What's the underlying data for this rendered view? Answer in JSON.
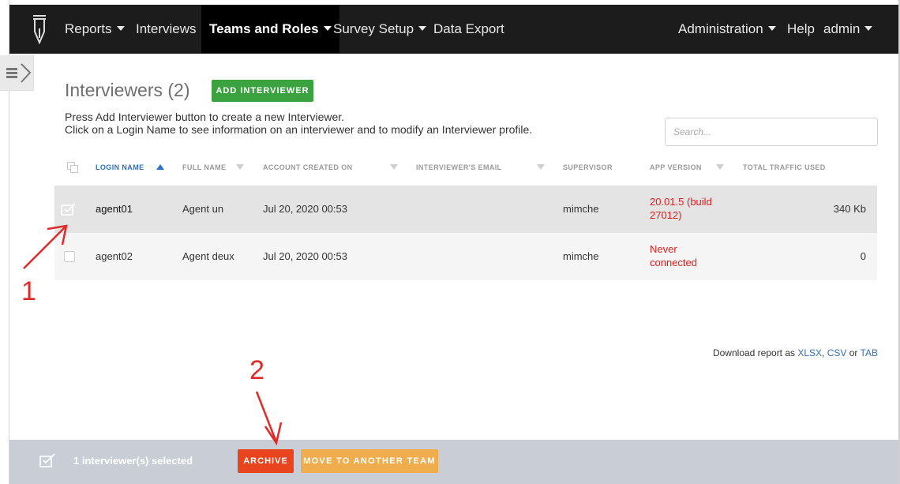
{
  "nav": {
    "items": [
      {
        "label": "Reports",
        "caret": true
      },
      {
        "label": "Interviews",
        "caret": false
      },
      {
        "label": "Teams and Roles",
        "caret": true,
        "active": true
      },
      {
        "label": "Survey Setup",
        "caret": true
      },
      {
        "label": "Data Export",
        "caret": false
      }
    ],
    "right": [
      {
        "label": "Administration",
        "caret": true
      },
      {
        "label": "Help",
        "caret": false
      },
      {
        "label": "admin",
        "caret": true
      }
    ]
  },
  "page": {
    "title": "Interviewers (2)",
    "add_button": "ADD INTERVIEWER",
    "instruction_1": "Press Add Interviewer button to create a new Interviewer.",
    "instruction_2": "Click on a Login Name to see information on an interviewer and to modify an Interviewer profile.",
    "search_placeholder": "Search..."
  },
  "table": {
    "columns": [
      "LOGIN NAME",
      "FULL NAME",
      "ACCOUNT CREATED ON",
      "INTERVIEWER'S EMAIL",
      "SUPERVISOR",
      "APP VERSION",
      "TOTAL TRAFFIC USED"
    ],
    "rows": [
      {
        "login": "agent01",
        "full_name": "Agent un",
        "created": "Jul 20, 2020 00:53",
        "email": "",
        "supervisor": "mimche",
        "app_version_1": "20.01.5 (build",
        "app_version_2": "27012)",
        "traffic": "340 Kb",
        "selected": true
      },
      {
        "login": "agent02",
        "full_name": "Agent deux",
        "created": "Jul 20, 2020 00:53",
        "email": "",
        "supervisor": "mimche",
        "app_version_1": "Never",
        "app_version_2": "connected",
        "traffic": "0",
        "selected": false
      }
    ]
  },
  "download": {
    "prefix": "Download report as ",
    "xlsx": "XLSX",
    "sep": ",",
    "csv": "CSV",
    "or": " or ",
    "tab": "TAB"
  },
  "bottom": {
    "selected_text": "1 interviewer(s) selected",
    "archive": "ARCHIVE",
    "move": "MOVE TO ANOTHER TEAM"
  },
  "annotations": {
    "one": "1",
    "two": "2"
  },
  "colors": {
    "accent_green": "#3aa23f",
    "archive_red": "#e8451e",
    "move_orange": "#f0ad4e",
    "link_blue": "#2f70c0",
    "warning_red": "#e02020"
  }
}
